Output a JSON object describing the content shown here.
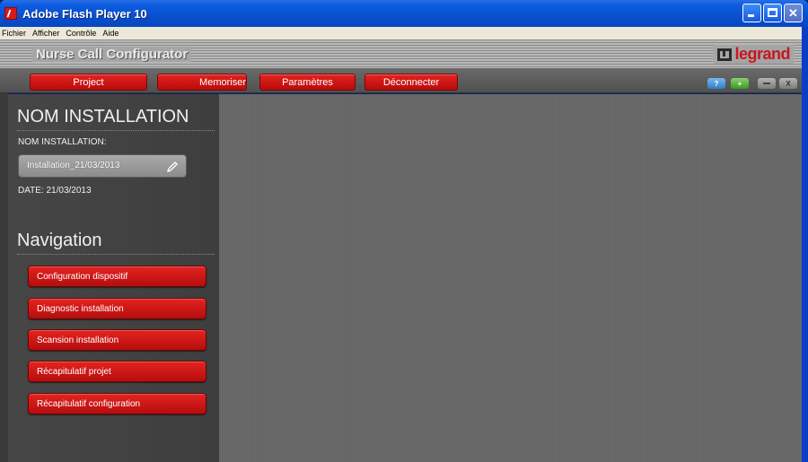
{
  "window": {
    "title": "Adobe Flash Player 10"
  },
  "menubar": {
    "items": [
      "Fichier",
      "Afficher",
      "Contrôle",
      "Aide"
    ]
  },
  "app": {
    "title": "Nurse Call Configurator",
    "logo_text": "legrand"
  },
  "toolbar": {
    "buttons": [
      "Project",
      "Memoriser",
      "Paramètres",
      "Déconnecter"
    ],
    "help_label": "?",
    "add_label": "+",
    "close_label": "X"
  },
  "sidebar": {
    "install_heading": "NOM INSTALLATION",
    "name_label": "NOM INSTALLATION:",
    "name_value": "Installation_21/03/2013",
    "date_text": "DATE: 21/03/2013",
    "nav_heading": "Navigation",
    "nav_items": [
      "Configuration dispositif",
      "Diagnostic installation",
      "Scansion installation",
      "Récapitulatif projet",
      "Récapitulatif configuration"
    ]
  },
  "colors": {
    "accent_red": "#c8161d",
    "titlebar_blue": "#0b5ce0",
    "panel_gray": "#424242"
  }
}
